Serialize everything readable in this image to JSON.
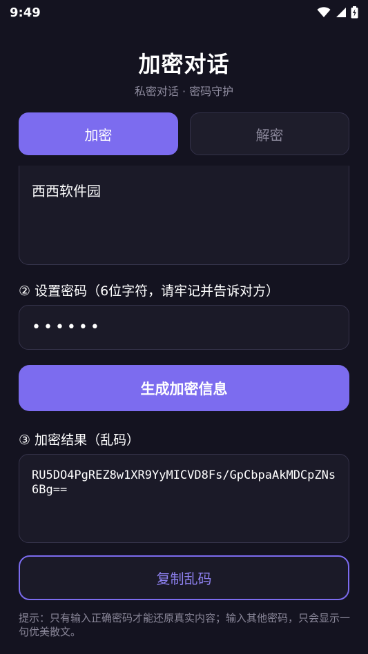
{
  "status_bar": {
    "time": "9:49"
  },
  "header": {
    "title": "加密对话",
    "subtitle": "私密对话 · 密码守护"
  },
  "tabs": [
    {
      "label": "加密",
      "active": true
    },
    {
      "label": "解密",
      "active": false
    }
  ],
  "message": {
    "value": "西西软件园"
  },
  "password": {
    "label": "② 设置密码（6位字符，请牢记并告诉对方）",
    "value": "••••••"
  },
  "generate_button": {
    "label": "生成加密信息"
  },
  "result": {
    "label": "③ 加密结果（乱码）",
    "value": "RU5DO4PgREZ8w1XR9YyMICVD8Fs/GpCbpaAkMDCpZNs6Bg=="
  },
  "copy_button": {
    "label": "复制乱码"
  },
  "hint": "提示：只有输入正确密码才能还原真实内容；输入其他密码，只会显示一句优美散文。",
  "colors": {
    "accent": "#7c6cef",
    "background": "#141320",
    "panel": "#1b1a28"
  }
}
